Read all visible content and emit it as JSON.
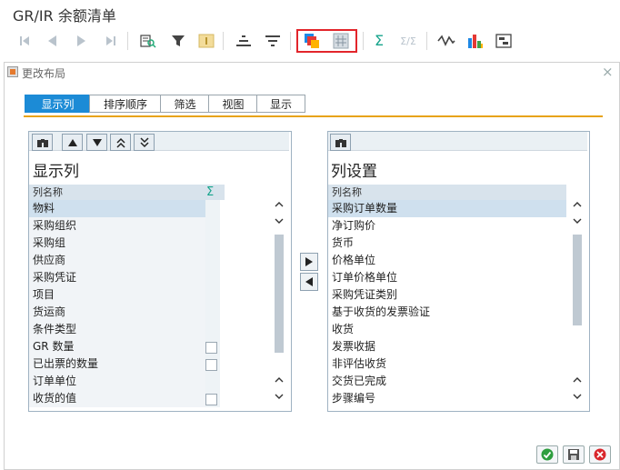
{
  "app": {
    "title": "GR/IR 余额清单"
  },
  "toolbar": {
    "icons": [
      "first-page-icon",
      "previous-page-icon",
      "next-page-icon",
      "last-page-icon",
      "details-icon",
      "filter-icon",
      "filter-value-icon",
      "sort-ascending-icon",
      "sort-descending-icon",
      "change-layout-icon",
      "select-layout-icon",
      "sum-icon",
      "subtotals-icon",
      "graphic-icon",
      "chart-icon",
      "export-icon"
    ],
    "labels": {
      "first": "|◀",
      "prev": "◀",
      "next": "▶",
      "last": "▶|",
      "sum": "Σ",
      "subtotal": "Σ/Σ"
    }
  },
  "dialog": {
    "title": "更改布局",
    "close_glyph": "×",
    "tabs": [
      "显示列",
      "排序顺序",
      "筛选",
      "视图",
      "显示"
    ],
    "active_tab": 0
  },
  "left_pane": {
    "title": "显示列",
    "column_header": "列名称",
    "sigma_header": "Σ",
    "rows": [
      {
        "label": "物料",
        "checkbox": false
      },
      {
        "label": "采购组织",
        "checkbox": false
      },
      {
        "label": "采购组",
        "checkbox": false
      },
      {
        "label": "供应商",
        "checkbox": false
      },
      {
        "label": "采购凭证",
        "checkbox": false
      },
      {
        "label": "项目",
        "checkbox": false
      },
      {
        "label": "货运商",
        "checkbox": false
      },
      {
        "label": "条件类型",
        "checkbox": false
      },
      {
        "label": "GR 数量",
        "checkbox": true
      },
      {
        "label": "已出票的数量",
        "checkbox": true
      },
      {
        "label": "订单单位",
        "checkbox": false
      },
      {
        "label": "收货的值",
        "checkbox": true
      }
    ],
    "selected_row": 0
  },
  "right_pane": {
    "title": "列设置",
    "column_header": "列名称",
    "rows": [
      "采购订单数量",
      "净订购价",
      "货币",
      "价格单位",
      "订单价格单位",
      "采购凭证类别",
      "基于收货的发票验证",
      "收货",
      "发票收据",
      "非评估收货",
      "交货已完成",
      "步骤编号"
    ],
    "selected_row": 0
  },
  "footer": {
    "buttons": [
      "confirm",
      "save",
      "cancel"
    ]
  }
}
